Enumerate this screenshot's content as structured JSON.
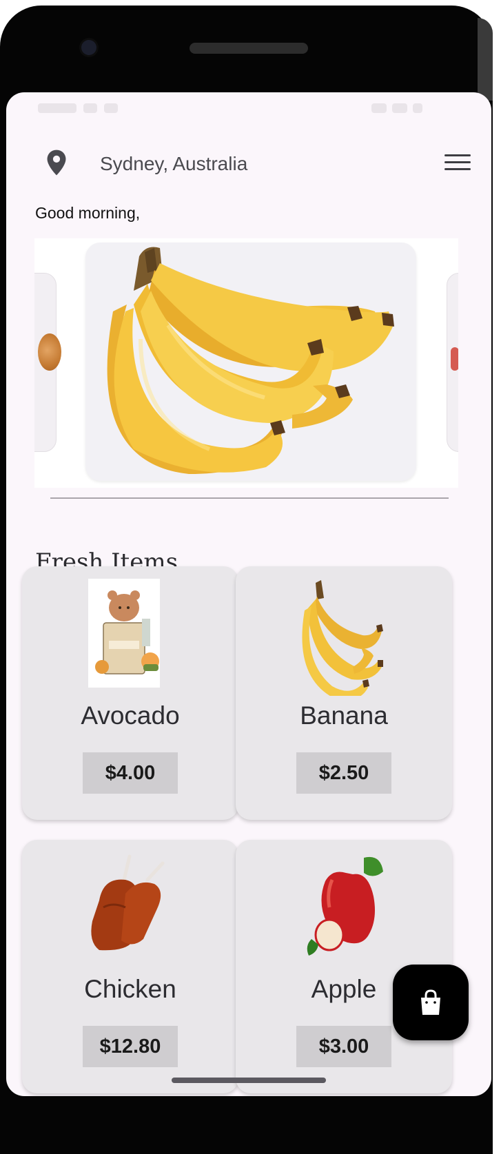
{
  "header": {
    "location": "Sydney, Australia",
    "location_icon": "map-pin-icon",
    "menu_icon": "hamburger-menu-icon"
  },
  "greeting": "Good morning,",
  "carousel": {
    "current_image": "banana-bunch-image"
  },
  "section_title": "Fresh Items",
  "products": [
    {
      "name": "Avocado",
      "price": "$4.00",
      "image": "avocado-grocery-bag-image"
    },
    {
      "name": "Banana",
      "price": "$2.50",
      "image": "banana-image"
    },
    {
      "name": "Chicken",
      "price": "$12.80",
      "image": "chicken-drumstick-image"
    },
    {
      "name": "Apple",
      "price": "$3.00",
      "image": "apple-image"
    }
  ],
  "fab": {
    "icon": "shopping-bag-icon"
  },
  "colors": {
    "screen_background": "#fbf6fb",
    "card_background": "#e9e7ea",
    "price_chip": "#cfcdd0",
    "fab": "#000000",
    "banana_yellow": "#f2c13a"
  }
}
